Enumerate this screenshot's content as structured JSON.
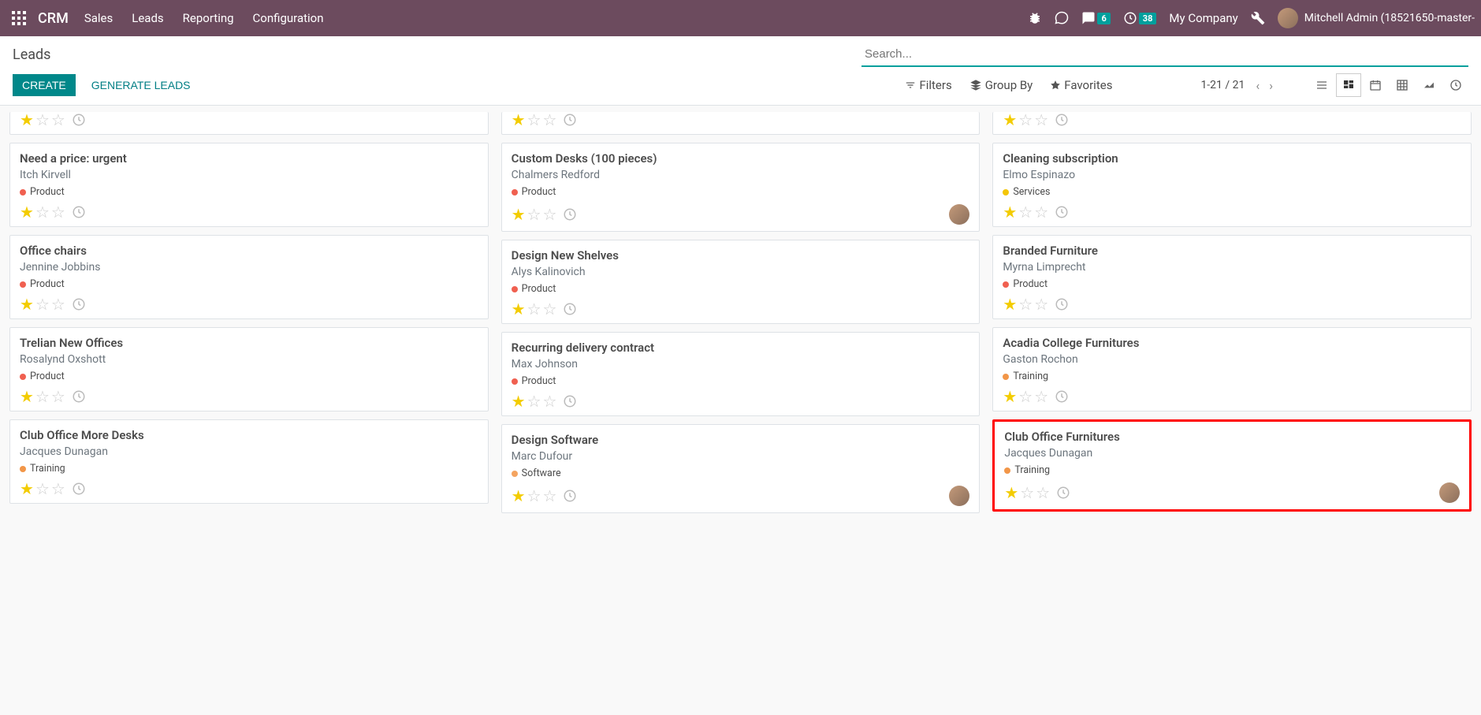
{
  "topbar": {
    "brand": "CRM",
    "nav": [
      "Sales",
      "Leads",
      "Reporting",
      "Configuration"
    ],
    "msg_badge": "6",
    "clock_badge": "38",
    "company": "My Company",
    "user": "Mitchell Admin (18521650-master-"
  },
  "cp": {
    "breadcrumb": "Leads",
    "search_placeholder": "Search...",
    "create": "CREATE",
    "generate": "GENERATE LEADS",
    "filters": "Filters",
    "groupby": "Group By",
    "favorites": "Favorites",
    "pager": "1-21 / 21"
  },
  "tags": {
    "product": "Product",
    "services": "Services",
    "training": "Training",
    "software": "Software"
  },
  "columns": [
    {
      "cards": [
        {
          "partial": true,
          "stars": 1,
          "avatar": false
        },
        {
          "title": "Need a price: urgent",
          "contact": "Itch Kirvell",
          "tag": "product",
          "stars": 1,
          "avatar": false
        },
        {
          "title": "Office chairs",
          "contact": "Jennine Jobbins",
          "tag": "product",
          "stars": 1,
          "avatar": false
        },
        {
          "title": "Trelian New Offices",
          "contact": "Rosalynd Oxshott",
          "tag": "product",
          "stars": 1,
          "avatar": false
        },
        {
          "title": "Club Office More Desks",
          "contact": "Jacques Dunagan",
          "tag": "training",
          "stars": 1,
          "avatar": false
        }
      ]
    },
    {
      "cards": [
        {
          "partial": true,
          "stars": 1,
          "avatar": false
        },
        {
          "title": "Custom Desks (100 pieces)",
          "contact": "Chalmers Redford",
          "tag": "product",
          "stars": 1,
          "avatar": true
        },
        {
          "title": "Design New Shelves",
          "contact": "Alys Kalinovich",
          "tag": "product",
          "stars": 1,
          "avatar": false
        },
        {
          "title": "Recurring delivery contract",
          "contact": "Max Johnson",
          "tag": "product",
          "stars": 1,
          "avatar": false
        },
        {
          "title": "Design Software",
          "contact": "Marc Dufour",
          "tag": "software",
          "stars": 1,
          "avatar": true
        }
      ]
    },
    {
      "cards": [
        {
          "partial": true,
          "stars": 1,
          "avatar": false
        },
        {
          "title": "Cleaning subscription",
          "contact": "Elmo Espinazo",
          "tag": "services",
          "stars": 1,
          "avatar": false
        },
        {
          "title": "Branded Furniture",
          "contact": "Myrna Limprecht",
          "tag": "product",
          "stars": 1,
          "avatar": false
        },
        {
          "title": "Acadia College Furnitures",
          "contact": "Gaston Rochon",
          "tag": "training",
          "stars": 1,
          "avatar": false
        },
        {
          "title": "Club Office Furnitures",
          "contact": "Jacques Dunagan",
          "tag": "training",
          "stars": 1,
          "avatar": true,
          "highlighted": true
        }
      ]
    }
  ]
}
